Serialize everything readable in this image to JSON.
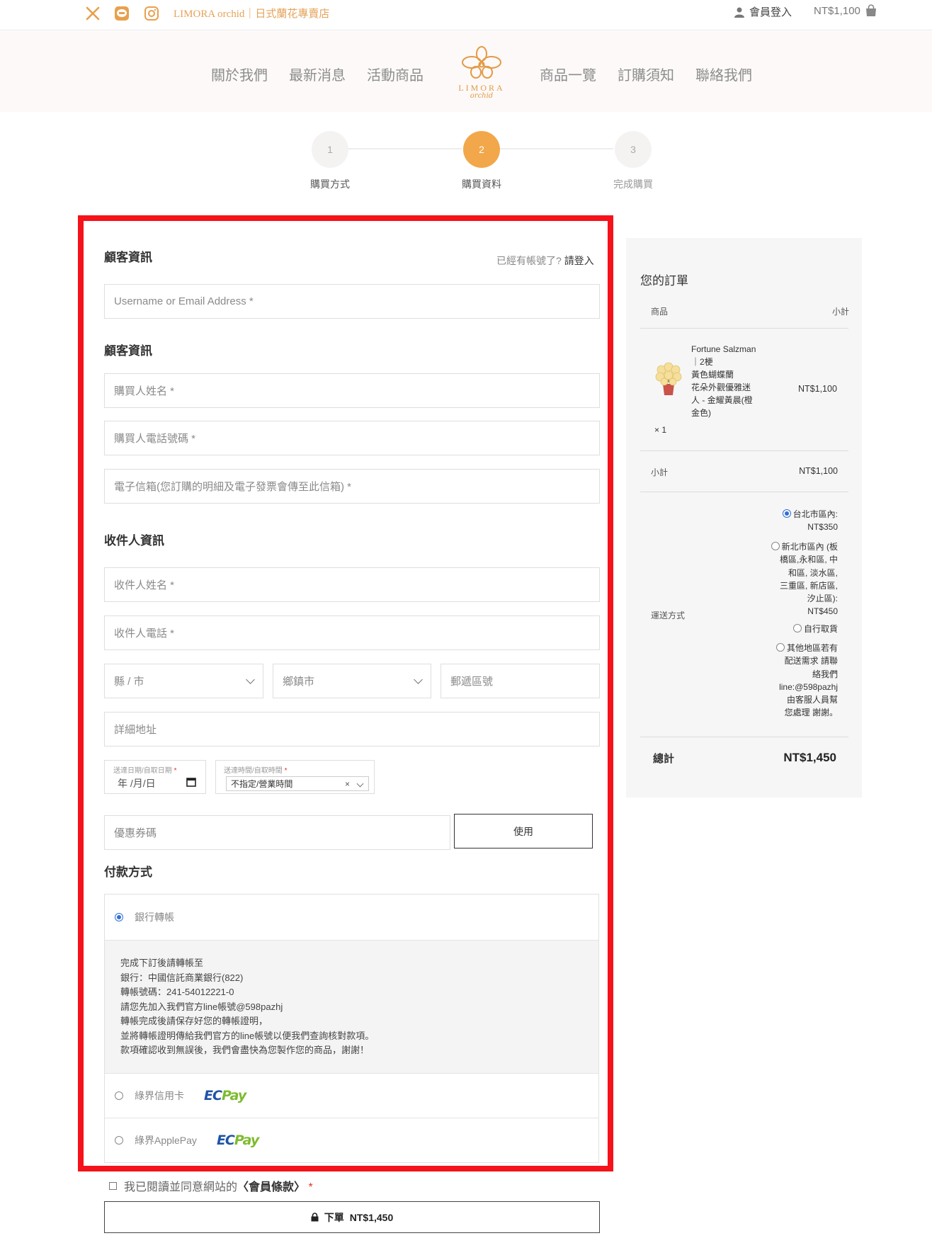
{
  "topbar": {
    "brand_text": "LIMORA orchid｜日式蘭花專賣店",
    "member_login": "會員登入",
    "cart_total": "NT$1,100",
    "icons": [
      "x-twitter-icon",
      "line-icon",
      "instagram-icon",
      "user-icon",
      "shopping-bag-icon"
    ]
  },
  "nav": {
    "items_left": [
      "關於我們",
      "最新消息",
      "活動商品"
    ],
    "items_right": [
      "商品一覽",
      "訂購須知",
      "聯絡我們"
    ],
    "logo_text": "LIMORA",
    "logo_sub": "orchid"
  },
  "steps": [
    {
      "number": "1",
      "label": "購買方式",
      "state": "done"
    },
    {
      "number": "2",
      "label": "購買資料",
      "state": "active"
    },
    {
      "number": "3",
      "label": "完成購買",
      "state": "pending"
    }
  ],
  "customer": {
    "title": "顧客資訊",
    "login_prompt": "已經有帳號了?",
    "login_link": "請登入",
    "username_placeholder": "Username or Email Address *"
  },
  "buyer": {
    "title": "顧客資訊",
    "name_placeholder": "購買人姓名 *",
    "phone_placeholder": "購買人電話號碼 *",
    "email_placeholder": "電子信箱(您訂購的明細及電子發票會傳至此信箱) *"
  },
  "recipient": {
    "title": "收件人資訊",
    "name_placeholder": "收件人姓名 *",
    "phone_placeholder": "收件人電話 *",
    "county_placeholder": "縣 / 市",
    "district_placeholder": "鄉鎮市",
    "zip_placeholder": "郵遞區號",
    "address_placeholder": "詳細地址",
    "date_label": "送達日期/自取日期",
    "date_value": "年 /月/日",
    "time_label": "送達時間/自取時間",
    "time_value": "不指定/營業時間",
    "clear_symbol": "×"
  },
  "coupon": {
    "placeholder": "優惠券碼",
    "apply_label": "使用"
  },
  "payment": {
    "title": "付款方式",
    "options": [
      {
        "label": "銀行轉帳",
        "selected": true
      },
      {
        "label": "綠界信用卡",
        "selected": false,
        "logo": "ECPay"
      },
      {
        "label": "綠界ApplePay",
        "selected": false,
        "logo": "ECPay"
      }
    ],
    "bank_instructions": [
      "完成下訂後請轉帳至",
      "銀行：中國信託商業銀行(822)",
      "轉帳號碼：241-54012221-0",
      "請您先加入我們官方line帳號@598pazhj",
      "轉帳完成後請保存好您的轉帳證明，",
      "並將轉帳證明傳給我們官方的line帳號以便我們查詢核對款項。",
      "款項確認收到無誤後，我們會盡快為您製作您的商品，謝謝！"
    ]
  },
  "terms": {
    "prefix": "我已閱讀並同意網站的",
    "link": "〈會員條款〉",
    "required": "*"
  },
  "order_button": {
    "label": "下單",
    "amount": "NT$1,450"
  },
  "order_summary": {
    "title": "您的訂單",
    "col_product": "商品",
    "col_subtotal": "小計",
    "product_lines": [
      "Fortune Salzman",
      "｜2梗",
      "黃色蝴蝶蘭",
      "花朵外觀優雅迷",
      "人 - 金耀黃晨(橙",
      "金色)"
    ],
    "product_price": "NT$1,100",
    "quantity": "× 1",
    "subtotal_label": "小計",
    "subtotal_value": "NT$1,100",
    "shipping_label": "運送方式",
    "shipping_options": [
      {
        "lines": [
          "台北市區內:",
          "NT$350"
        ],
        "selected": true
      },
      {
        "lines": [
          "新北市區內 (板",
          "橋區,永和區, 中",
          "和區, 淡水區,",
          "三重區, 新店區,",
          "汐止區):",
          "NT$450"
        ],
        "selected": false
      },
      {
        "lines": [
          "自行取貨"
        ],
        "selected": false
      },
      {
        "lines": [
          "其他地區若有",
          "配送需求 請聯",
          "絡我們",
          "line:@598pazhj",
          "由客服人員幫",
          "您處理 謝謝。"
        ],
        "selected": false
      }
    ],
    "total_label": "總計",
    "total_value": "NT$1,450"
  },
  "colors": {
    "accent": "#f2a74a",
    "brand_text": "#e5a35a",
    "highlight_border": "#f5121a",
    "radio_selected": "#2f6fd6"
  }
}
